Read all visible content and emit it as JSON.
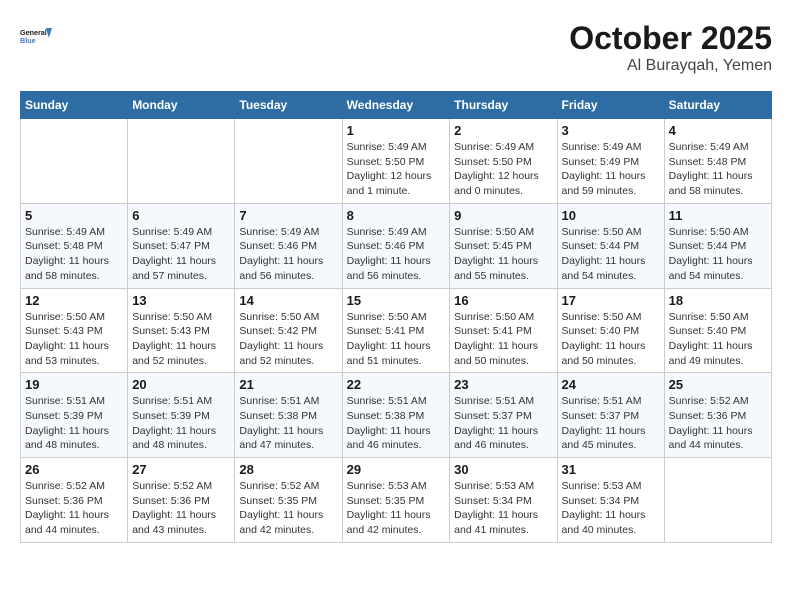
{
  "header": {
    "logo_line1": "General",
    "logo_line2": "Blue",
    "month": "October 2025",
    "location": "Al Burayqah, Yemen"
  },
  "weekdays": [
    "Sunday",
    "Monday",
    "Tuesday",
    "Wednesday",
    "Thursday",
    "Friday",
    "Saturday"
  ],
  "weeks": [
    [
      {
        "day": "",
        "info": ""
      },
      {
        "day": "",
        "info": ""
      },
      {
        "day": "",
        "info": ""
      },
      {
        "day": "1",
        "info": "Sunrise: 5:49 AM\nSunset: 5:50 PM\nDaylight: 12 hours\nand 1 minute."
      },
      {
        "day": "2",
        "info": "Sunrise: 5:49 AM\nSunset: 5:50 PM\nDaylight: 12 hours\nand 0 minutes."
      },
      {
        "day": "3",
        "info": "Sunrise: 5:49 AM\nSunset: 5:49 PM\nDaylight: 11 hours\nand 59 minutes."
      },
      {
        "day": "4",
        "info": "Sunrise: 5:49 AM\nSunset: 5:48 PM\nDaylight: 11 hours\nand 58 minutes."
      }
    ],
    [
      {
        "day": "5",
        "info": "Sunrise: 5:49 AM\nSunset: 5:48 PM\nDaylight: 11 hours\nand 58 minutes."
      },
      {
        "day": "6",
        "info": "Sunrise: 5:49 AM\nSunset: 5:47 PM\nDaylight: 11 hours\nand 57 minutes."
      },
      {
        "day": "7",
        "info": "Sunrise: 5:49 AM\nSunset: 5:46 PM\nDaylight: 11 hours\nand 56 minutes."
      },
      {
        "day": "8",
        "info": "Sunrise: 5:49 AM\nSunset: 5:46 PM\nDaylight: 11 hours\nand 56 minutes."
      },
      {
        "day": "9",
        "info": "Sunrise: 5:50 AM\nSunset: 5:45 PM\nDaylight: 11 hours\nand 55 minutes."
      },
      {
        "day": "10",
        "info": "Sunrise: 5:50 AM\nSunset: 5:44 PM\nDaylight: 11 hours\nand 54 minutes."
      },
      {
        "day": "11",
        "info": "Sunrise: 5:50 AM\nSunset: 5:44 PM\nDaylight: 11 hours\nand 54 minutes."
      }
    ],
    [
      {
        "day": "12",
        "info": "Sunrise: 5:50 AM\nSunset: 5:43 PM\nDaylight: 11 hours\nand 53 minutes."
      },
      {
        "day": "13",
        "info": "Sunrise: 5:50 AM\nSunset: 5:43 PM\nDaylight: 11 hours\nand 52 minutes."
      },
      {
        "day": "14",
        "info": "Sunrise: 5:50 AM\nSunset: 5:42 PM\nDaylight: 11 hours\nand 52 minutes."
      },
      {
        "day": "15",
        "info": "Sunrise: 5:50 AM\nSunset: 5:41 PM\nDaylight: 11 hours\nand 51 minutes."
      },
      {
        "day": "16",
        "info": "Sunrise: 5:50 AM\nSunset: 5:41 PM\nDaylight: 11 hours\nand 50 minutes."
      },
      {
        "day": "17",
        "info": "Sunrise: 5:50 AM\nSunset: 5:40 PM\nDaylight: 11 hours\nand 50 minutes."
      },
      {
        "day": "18",
        "info": "Sunrise: 5:50 AM\nSunset: 5:40 PM\nDaylight: 11 hours\nand 49 minutes."
      }
    ],
    [
      {
        "day": "19",
        "info": "Sunrise: 5:51 AM\nSunset: 5:39 PM\nDaylight: 11 hours\nand 48 minutes."
      },
      {
        "day": "20",
        "info": "Sunrise: 5:51 AM\nSunset: 5:39 PM\nDaylight: 11 hours\nand 48 minutes."
      },
      {
        "day": "21",
        "info": "Sunrise: 5:51 AM\nSunset: 5:38 PM\nDaylight: 11 hours\nand 47 minutes."
      },
      {
        "day": "22",
        "info": "Sunrise: 5:51 AM\nSunset: 5:38 PM\nDaylight: 11 hours\nand 46 minutes."
      },
      {
        "day": "23",
        "info": "Sunrise: 5:51 AM\nSunset: 5:37 PM\nDaylight: 11 hours\nand 46 minutes."
      },
      {
        "day": "24",
        "info": "Sunrise: 5:51 AM\nSunset: 5:37 PM\nDaylight: 11 hours\nand 45 minutes."
      },
      {
        "day": "25",
        "info": "Sunrise: 5:52 AM\nSunset: 5:36 PM\nDaylight: 11 hours\nand 44 minutes."
      }
    ],
    [
      {
        "day": "26",
        "info": "Sunrise: 5:52 AM\nSunset: 5:36 PM\nDaylight: 11 hours\nand 44 minutes."
      },
      {
        "day": "27",
        "info": "Sunrise: 5:52 AM\nSunset: 5:36 PM\nDaylight: 11 hours\nand 43 minutes."
      },
      {
        "day": "28",
        "info": "Sunrise: 5:52 AM\nSunset: 5:35 PM\nDaylight: 11 hours\nand 42 minutes."
      },
      {
        "day": "29",
        "info": "Sunrise: 5:53 AM\nSunset: 5:35 PM\nDaylight: 11 hours\nand 42 minutes."
      },
      {
        "day": "30",
        "info": "Sunrise: 5:53 AM\nSunset: 5:34 PM\nDaylight: 11 hours\nand 41 minutes."
      },
      {
        "day": "31",
        "info": "Sunrise: 5:53 AM\nSunset: 5:34 PM\nDaylight: 11 hours\nand 40 minutes."
      },
      {
        "day": "",
        "info": ""
      }
    ]
  ]
}
